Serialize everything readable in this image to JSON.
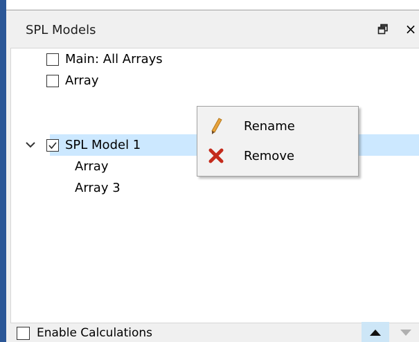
{
  "panel": {
    "title": "SPL Models",
    "float_icon": "float-window-icon",
    "close_label": "×"
  },
  "tree": {
    "items": [
      {
        "label": "Main: All Arrays",
        "checked": false
      },
      {
        "label": "Array",
        "checked": false
      },
      {
        "label": "SPL Model 1",
        "checked": true,
        "expanded": true,
        "selected": true
      },
      {
        "label": "Array"
      },
      {
        "label": "Array 3"
      }
    ]
  },
  "context_menu": {
    "items": [
      {
        "label": "Rename",
        "icon": "pencil-icon"
      },
      {
        "label": "Remove",
        "icon": "red-x-icon"
      }
    ]
  },
  "footer": {
    "enable_label": "Enable Calculations",
    "enable_checked": false
  },
  "colors": {
    "selection": "#cce8ff",
    "window_edge": "#2b5797",
    "remove_icon": "#c42b1c",
    "pencil": "#e8a33d"
  }
}
